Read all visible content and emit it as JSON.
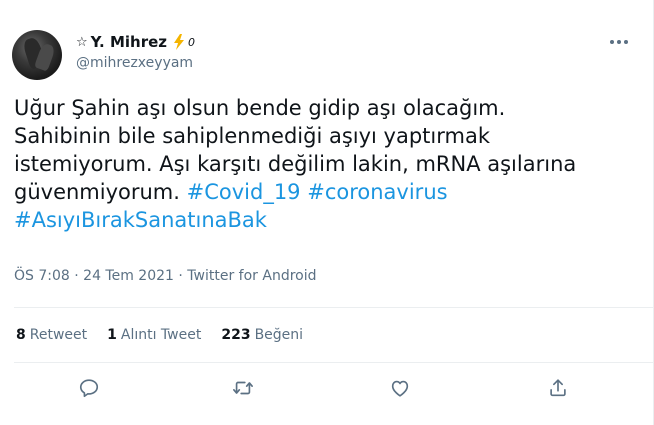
{
  "author": {
    "star": "☆",
    "name": "Y. Mihrez",
    "badge_suffix": "0",
    "handle": "@mihrezxeyyam"
  },
  "tweet": {
    "text_plain": "Uğur Şahin aşı olsun bende gidip aşı olacağım.\nSahibinin bile sahiplenmediği aşıyı yaptırmak\nistemiyorum. Aşı karşıtı değilim lakin, mRNA aşılarına\ngüvenmiyorum. ",
    "hashtags": [
      "#Covid_19",
      "#coronavirus",
      "#AsıyıBırakSanatınaBak"
    ]
  },
  "meta": {
    "time": "ÖS 7:08",
    "sep1": " · ",
    "date": "24 Tem 2021",
    "sep2": " · ",
    "source": "Twitter for Android"
  },
  "stats": {
    "retweets_count": "8",
    "retweets_label": "Retweet",
    "quotes_count": "1",
    "quotes_label": "Alıntı Tweet",
    "likes_count": "223",
    "likes_label": "Beğeni"
  },
  "icons": {
    "more": "more-icon",
    "reply": "reply-icon",
    "retweet": "retweet-icon",
    "like": "heart-icon",
    "share": "share-icon",
    "bolt": "lightning-bolt-icon",
    "bolt_color": "#f4b400",
    "action_color": "#5b7083",
    "hashtag_color": "#1b95e0"
  }
}
